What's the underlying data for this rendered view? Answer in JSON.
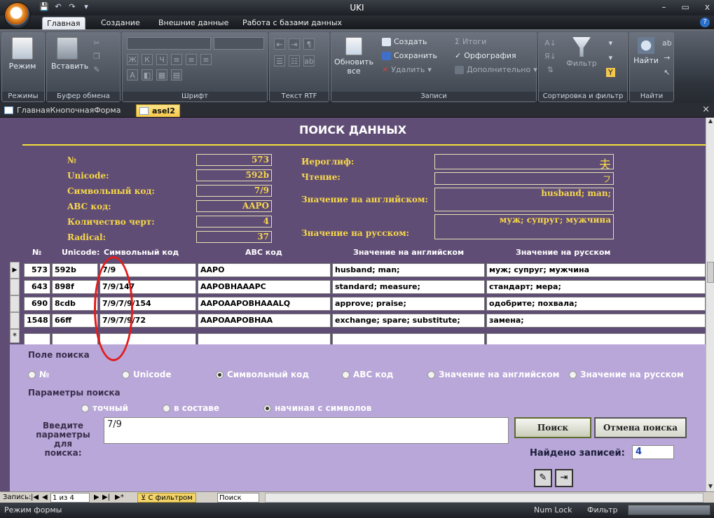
{
  "app": {
    "title": "UKI",
    "window_controls": [
      "–",
      "▭",
      "x"
    ]
  },
  "ribbon": {
    "tabs": [
      "Главная",
      "Создание",
      "Внешние данные",
      "Работа с базами данных"
    ],
    "groups": {
      "views": {
        "label": "Режимы",
        "button": "Режим"
      },
      "clipboard": {
        "label": "Буфер обмена",
        "button": "Вставить"
      },
      "font": {
        "label": "Шрифт"
      },
      "richtext": {
        "label": "Текст RTF"
      },
      "records": {
        "label": "Записи",
        "refresh": "Обновить все",
        "create": "Создать",
        "save": "Сохранить",
        "delete": "Удалить",
        "totals": "Итоги",
        "spelling": "Орфография",
        "more": "Дополнительно"
      },
      "sortfilter": {
        "label": "Сортировка и фильтр",
        "filter": "Фильтр"
      },
      "find": {
        "label": "Найти",
        "find": "Найти"
      }
    }
  },
  "doc_tabs": [
    "ГлавнаяКнопочнаяФорма",
    "asel2"
  ],
  "form": {
    "title": "ПОИСК ДАННЫХ",
    "fields_left": [
      {
        "label": "№",
        "value": "573"
      },
      {
        "label": "Unicode:",
        "value": "592b"
      },
      {
        "label": "Символьный код:",
        "value": "7/9"
      },
      {
        "label": "ABC код:",
        "value": "AAPO"
      },
      {
        "label": "Количество черт:",
        "value": "4"
      },
      {
        "label": "Radical:",
        "value": "37"
      }
    ],
    "fields_right": [
      {
        "label": "Иероглиф:",
        "value": "夫"
      },
      {
        "label": "Чтение:",
        "value": "フ"
      },
      {
        "label": "Значение на английском:",
        "value": "husband; man;"
      },
      {
        "label": "Значение на русском:",
        "value": "муж; супруг; мужчина"
      }
    ],
    "columns": [
      "№",
      "Unicode:",
      "Символьный код",
      "ABC код",
      "Значение на английском",
      "Значение на русском"
    ],
    "rows": [
      [
        "573",
        "592b",
        "7/9",
        "AAPO",
        "husband; man;",
        "муж; супруг; мужчина"
      ],
      [
        "643",
        "898f",
        "7/9/147",
        "AAPOBHAAAPC",
        "standard; measure;",
        "стандарт; мера;"
      ],
      [
        "690",
        "8cdb",
        "7/9/7/9/154",
        "AAPOAAPOBHAAALQ",
        "approve; praise;",
        "одобрите; похвала;"
      ],
      [
        "1548",
        "66ff",
        "7/9/7/9/72",
        "AAPOAAPOBHAA",
        "exchange; spare; substitute;",
        "замена;"
      ]
    ],
    "search_field_label": "Поле поиска",
    "search_fields": [
      "№",
      "Unicode",
      "Символьный код",
      "ABC код",
      "Значение на английском",
      "Значение на русском"
    ],
    "search_field_selected": "Символьный код",
    "search_params_label": "Параметры поиска",
    "search_params": [
      "точный",
      "в составе",
      "начиная с символов"
    ],
    "search_param_selected": "начиная с символов",
    "enter_label": "Введите параметры для поиска:",
    "search_value": "7/9",
    "search_button": "Поиск",
    "cancel_button": "Отмена поиска",
    "found_label": "Найдено записей:",
    "found_count": "4"
  },
  "record_nav": {
    "label": "Запись:",
    "position": "1 из 4",
    "filter_state": "С фильтром",
    "search_box": "Поиск"
  },
  "status": {
    "mode": "Режим формы",
    "numlock": "Num Lock",
    "filter": "Фильтр"
  }
}
